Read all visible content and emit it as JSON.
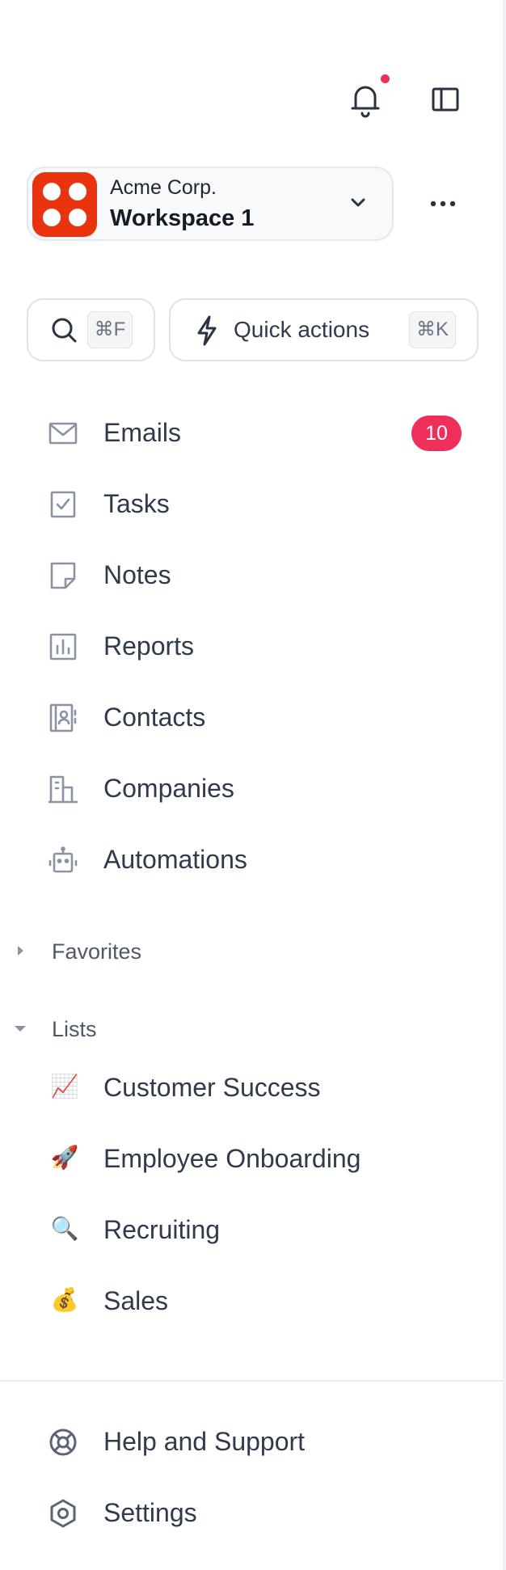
{
  "header": {
    "notifications_icon": "bell-icon",
    "notification_dot_color": "#ee2f5b",
    "panel_toggle_icon": "sidebar-toggle-icon"
  },
  "workspace": {
    "company": "Acme Corp.",
    "name": "Workspace 1",
    "logo_color": "#e8330f",
    "chevron_icon": "chevron-down-icon",
    "more_icon": "more-horizontal-icon"
  },
  "search": {
    "icon": "search-icon",
    "shortcut": "⌘F"
  },
  "quick_actions": {
    "icon": "lightning-icon",
    "label": "Quick actions",
    "shortcut": "⌘K"
  },
  "nav": {
    "items": [
      {
        "label": "Emails",
        "icon": "mail-icon",
        "badge": "10"
      },
      {
        "label": "Tasks",
        "icon": "checkbox-icon"
      },
      {
        "label": "Notes",
        "icon": "note-icon"
      },
      {
        "label": "Reports",
        "icon": "chart-icon"
      },
      {
        "label": "Contacts",
        "icon": "contacts-icon"
      },
      {
        "label": "Companies",
        "icon": "building-icon"
      },
      {
        "label": "Automations",
        "icon": "robot-icon"
      }
    ]
  },
  "favorites": {
    "label": "Favorites",
    "expanded": false
  },
  "lists": {
    "label": "Lists",
    "expanded": true,
    "items": [
      {
        "label": "Customer Success",
        "emoji": "📈"
      },
      {
        "label": "Employee Onboarding",
        "emoji": "🚀"
      },
      {
        "label": "Recruiting",
        "emoji": "🔍"
      },
      {
        "label": "Sales",
        "emoji": "💰"
      }
    ]
  },
  "footer": {
    "items": [
      {
        "label": "Help and Support",
        "icon": "lifebuoy-icon"
      },
      {
        "label": "Settings",
        "icon": "settings-icon"
      }
    ]
  },
  "colors": {
    "text": "#2f3a4d",
    "icon": "#8a93a3",
    "badge": "#ee2f5b",
    "border": "#dfe3e9"
  }
}
